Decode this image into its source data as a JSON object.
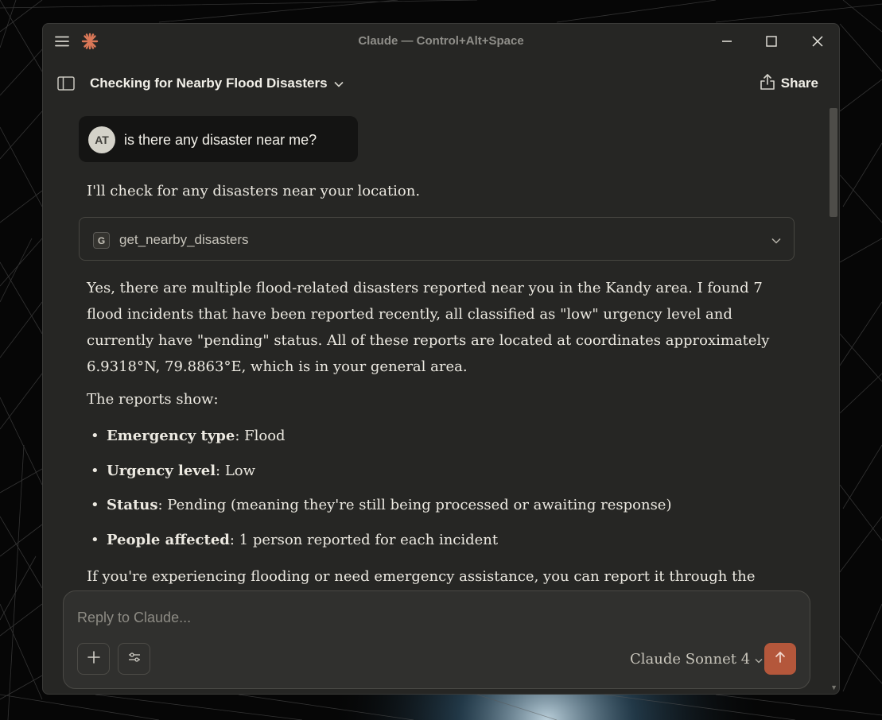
{
  "window": {
    "title": "Claude — Control+Alt+Space"
  },
  "header": {
    "conversation_title": "Checking for Nearby Flood Disasters",
    "share_label": "Share"
  },
  "messages": {
    "user": {
      "avatar_initials": "AT",
      "text": "is there any disaster near me?"
    },
    "assistant": {
      "intro": "I'll check for any disasters near your location.",
      "tool_call": {
        "badge": "G",
        "name": "get_nearby_disasters"
      },
      "paragraph1": "Yes, there are multiple flood-related disasters reported near you in the Kandy area. I found 7 flood incidents that have been reported recently, all classified as \"low\" urgency level and currently have \"pending\" status. All of these reports are located at coordinates approximately 6.9318°N, 79.8863°E, which is in your general area.",
      "paragraph2": "The reports show:",
      "bullets": [
        {
          "label": "Emergency type",
          "value": ": Flood"
        },
        {
          "label": "Urgency level",
          "value": ": Low"
        },
        {
          "label": "Status",
          "value": ": Pending (meaning they're still being processed or awaiting response)"
        },
        {
          "label": "People affected",
          "value": ": 1 person reported for each incident"
        }
      ],
      "paragraph3": "If you're experiencing flooding or need emergency assistance, you can report it through the"
    }
  },
  "composer": {
    "placeholder": "Reply to Claude...",
    "model": "Claude Sonnet 4"
  },
  "icons": {
    "menu": "menu-icon",
    "logo": "claude-logo-icon",
    "minimize": "minimize-icon",
    "maximize": "maximize-icon",
    "close": "close-icon",
    "sidebar": "sidebar-toggle-icon",
    "share": "share-icon",
    "chevron": "chevron-down-icon",
    "add": "plus-icon",
    "tools": "sliders-icon",
    "send": "arrow-up-icon"
  },
  "colors": {
    "window_bg": "#262624",
    "user_bubble": "#141413",
    "accent": "#b4573b",
    "logo": "#d97757"
  }
}
